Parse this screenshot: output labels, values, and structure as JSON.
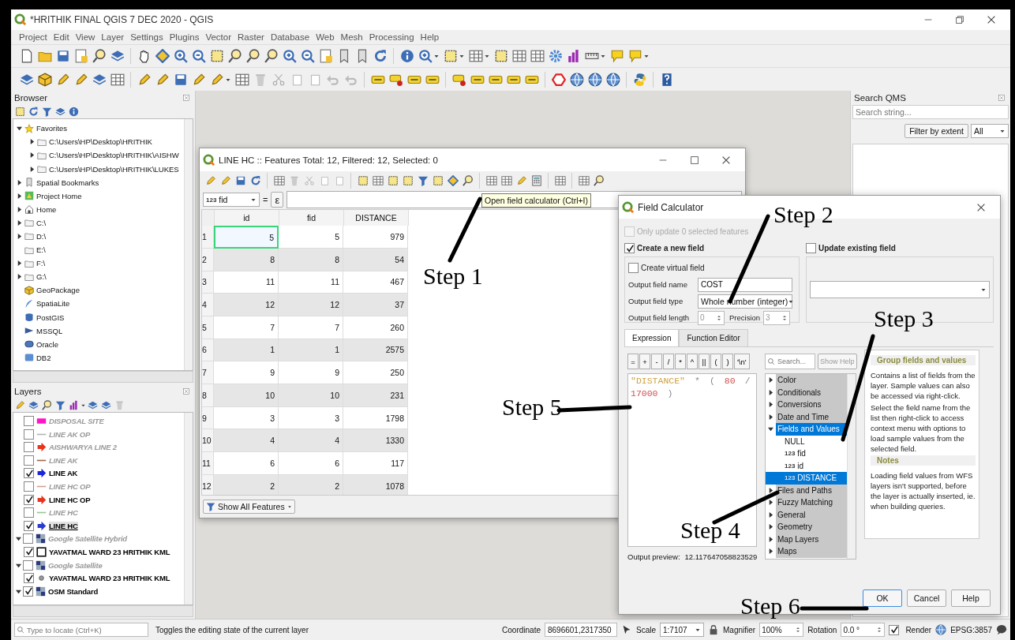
{
  "window": {
    "title": "*HRITHIK FINAL QGIS 7 DEC 2020 - QGIS"
  },
  "menu": [
    "Project",
    "Edit",
    "View",
    "Layer",
    "Settings",
    "Plugins",
    "Vector",
    "Raster",
    "Database",
    "Web",
    "Mesh",
    "Processing",
    "Help"
  ],
  "browser": {
    "title": "Browser",
    "items": [
      {
        "label": "Favorites",
        "kind": "star",
        "expanded": true,
        "children": [
          {
            "label": "C:\\Users\\HP\\Desktop\\HRITHIK",
            "kind": "folder",
            "expanded": false
          },
          {
            "label": "C:\\Users\\HP\\Desktop\\HRITHIK\\AISHW",
            "kind": "folder",
            "expanded": false
          },
          {
            "label": "C:\\Users\\HP\\Desktop\\HRITHIK\\LUKES",
            "kind": "folder",
            "expanded": false
          }
        ]
      },
      {
        "label": "Spatial Bookmarks",
        "kind": "bookmarks",
        "expanded": false
      },
      {
        "label": "Project Home",
        "kind": "project",
        "expanded": false
      },
      {
        "label": "Home",
        "kind": "home",
        "expanded": false
      },
      {
        "label": "C:\\",
        "kind": "folder",
        "expanded": false
      },
      {
        "label": "D:\\",
        "kind": "folder",
        "expanded": false
      },
      {
        "label": "E:\\",
        "kind": "folder"
      },
      {
        "label": "F:\\",
        "kind": "folder",
        "expanded": false
      },
      {
        "label": "G:\\",
        "kind": "folder",
        "expanded": false
      },
      {
        "label": "GeoPackage",
        "kind": "geopackage"
      },
      {
        "label": "SpatiaLite",
        "kind": "spatialite"
      },
      {
        "label": "PostGIS",
        "kind": "postgis"
      },
      {
        "label": "MSSQL",
        "kind": "mssql"
      },
      {
        "label": "Oracle",
        "kind": "oracle"
      },
      {
        "label": "DB2",
        "kind": "db2"
      }
    ]
  },
  "layers": {
    "title": "Layers",
    "items": [
      {
        "label": "DISPOSAL SITE",
        "checked": false,
        "selected": false,
        "kind": "fill",
        "color": "#ff14c8"
      },
      {
        "label": "LINE AK OP",
        "checked": false,
        "selected": false,
        "kind": "line",
        "color": "#b4b4b4"
      },
      {
        "label": "AISHWARYA LINE 2",
        "checked": false,
        "selected": false,
        "kind": "arrow",
        "color": "#e8341c"
      },
      {
        "label": "LINE AK",
        "checked": false,
        "selected": false,
        "kind": "line",
        "color": "#9a6a48"
      },
      {
        "label": "LINE AK",
        "checked": true,
        "selected": false,
        "kind": "arrow",
        "color": "#1a24d8"
      },
      {
        "label": "LINE HC OP",
        "checked": false,
        "selected": false,
        "kind": "line",
        "color": "#d0a090"
      },
      {
        "label": "LINE HC OP",
        "checked": true,
        "selected": false,
        "kind": "arrow",
        "color": "#e8341c"
      },
      {
        "label": "LINE HC",
        "checked": false,
        "selected": false,
        "kind": "line",
        "color": "#98c498"
      },
      {
        "label": "LINE HC",
        "checked": true,
        "selected": true,
        "kind": "arrow",
        "color": "#2a3ad0"
      },
      {
        "label": "Google Satellite Hybrid",
        "checked": false,
        "selected": false,
        "kind": "tile",
        "expanded": true
      },
      {
        "label": "YAVATMAL WARD 23 HRITHIK KML",
        "checked": true,
        "selected": false,
        "kind": "square"
      },
      {
        "label": "Google Satellite",
        "checked": false,
        "selected": false,
        "kind": "tile",
        "expanded": true
      },
      {
        "label": "YAVATMAL WARD 23 HRITHIK KML",
        "checked": true,
        "selected": false,
        "kind": "point"
      },
      {
        "label": "OSM Standard",
        "checked": true,
        "selected": false,
        "kind": "tile",
        "expanded": true
      }
    ]
  },
  "search_qms": {
    "title": "Search QMS",
    "placeholder": "Search string...",
    "filter_button": "Filter by extent",
    "filter_value": "All"
  },
  "attribute_table": {
    "title": "LINE HC :: Features Total: 12, Filtered: 12, Selected: 0",
    "field_type_badge": "123",
    "field_value": "fid",
    "operator": "=",
    "expression_button": "ε",
    "columns": [
      "id",
      "fid",
      "DISTANCE"
    ],
    "rows": [
      {
        "number": "1",
        "cells": [
          "5",
          "5",
          "979"
        ],
        "selected": false,
        "focused": true
      },
      {
        "number": "2",
        "cells": [
          "8",
          "8",
          "54"
        ],
        "selected": false,
        "focused": false
      },
      {
        "number": "3",
        "cells": [
          "11",
          "11",
          "467"
        ],
        "selected": false,
        "focused": false
      },
      {
        "number": "4",
        "cells": [
          "12",
          "12",
          "37"
        ],
        "selected": false,
        "focused": false
      },
      {
        "number": "5",
        "cells": [
          "7",
          "7",
          "260"
        ],
        "selected": false,
        "focused": false
      },
      {
        "number": "6",
        "cells": [
          "1",
          "1",
          "2575"
        ],
        "selected": false,
        "focused": false
      },
      {
        "number": "7",
        "cells": [
          "9",
          "9",
          "250"
        ],
        "selected": false,
        "focused": false
      },
      {
        "number": "8",
        "cells": [
          "10",
          "10",
          "231"
        ],
        "selected": false,
        "focused": false
      },
      {
        "number": "9",
        "cells": [
          "3",
          "3",
          "1798"
        ],
        "selected": false,
        "focused": false
      },
      {
        "number": "10",
        "cells": [
          "4",
          "4",
          "1330"
        ],
        "selected": false,
        "focused": false
      },
      {
        "number": "11",
        "cells": [
          "6",
          "6",
          "117"
        ],
        "selected": false,
        "focused": false
      },
      {
        "number": "12",
        "cells": [
          "2",
          "2",
          "1078"
        ],
        "selected": false,
        "focused": false
      }
    ],
    "show_all": "Show All Features"
  },
  "tooltip": {
    "text": "Open field calculator (Ctrl+I)"
  },
  "field_calculator": {
    "title": "Field Calculator",
    "only_update": {
      "label": "Only update 0 selected features",
      "checked": false,
      "disabled": true
    },
    "create_new": {
      "label": "Create a new field",
      "checked": true
    },
    "virtual": {
      "label": "Create virtual field",
      "checked": false
    },
    "name_label": "Output field name",
    "name_value": "COST",
    "type_label": "Output field type",
    "type_value": "Whole number (integer)",
    "length_label": "Output field length",
    "length_value": "0",
    "precision_label": "Precision",
    "precision_value": "3",
    "update_existing": {
      "label": "Update existing field",
      "checked": false
    },
    "tabs": [
      {
        "label": "Expression",
        "selected": true
      },
      {
        "label": "Function Editor",
        "selected": false
      }
    ],
    "operators": [
      "=",
      "+",
      "-",
      "/",
      "*",
      "^",
      "||",
      "(",
      ")",
      "'\\n'"
    ],
    "expression_lines": [
      [
        {
          "text": "\"DISTANCE\"",
          "kind": "field"
        },
        {
          "text": "*",
          "kind": "operator"
        },
        {
          "text": "(",
          "kind": "operator"
        },
        {
          "text": "80",
          "kind": "number"
        },
        {
          "text": "/",
          "kind": "operator"
        }
      ],
      [
        {
          "text": "17000",
          "kind": "number"
        },
        {
          "text": ")",
          "kind": "operator"
        }
      ]
    ],
    "preview_label": "Output preview:",
    "preview_value": "12.117647058823529",
    "search_placeholder": "Search...",
    "show_help": "Show Help",
    "functions": [
      {
        "label": "Color",
        "expanded": false,
        "selected": false
      },
      {
        "label": "Conditionals",
        "expanded": false,
        "selected": false
      },
      {
        "label": "Conversions",
        "expanded": false,
        "selected": false
      },
      {
        "label": "Date and Time",
        "expanded": false,
        "selected": false
      },
      {
        "label": "Fields and Values",
        "expanded": true,
        "selected": true,
        "children": [
          {
            "label": "NULL",
            "selected": false
          },
          {
            "type_badge": "123",
            "label": "fid",
            "selected": false
          },
          {
            "type_badge": "123",
            "label": "id",
            "selected": false
          },
          {
            "type_badge": "123",
            "label": "DISTANCE",
            "selected": true
          }
        ]
      },
      {
        "label": "Files and Paths",
        "expanded": false,
        "selected": false
      },
      {
        "label": "Fuzzy Matching",
        "expanded": false,
        "selected": false
      },
      {
        "label": "General",
        "expanded": false,
        "selected": false
      },
      {
        "label": "Geometry",
        "expanded": false,
        "selected": false
      },
      {
        "label": "Map Layers",
        "expanded": false,
        "selected": false
      },
      {
        "label": "Maps",
        "expanded": false,
        "selected": false
      }
    ],
    "help": {
      "title": "Group fields and values",
      "paragraphs": [
        "Contains a list of fields from the layer. Sample values can also be accessed via right-click.",
        "Select the field name from the list then right-click to access context menu with options to load sample values from the selected field."
      ],
      "notes_title": "Notes",
      "notes": "Loading field values from WFS layers isn't supported, before the layer is actually inserted, ie. when building queries."
    },
    "buttons": [
      {
        "label": "OK",
        "default": true
      },
      {
        "label": "Cancel",
        "default": false
      },
      {
        "label": "Help",
        "default": false
      }
    ]
  },
  "status_bar": {
    "locate_placeholder": "Type to locate (Ctrl+K)",
    "message": "Toggles the editing state of the current layer",
    "coordinate_label": "Coordinate",
    "coordinate": "8696601,2317350",
    "scale_label": "Scale",
    "scale": "1:7107",
    "magnifier_label": "Magnifier",
    "magnifier": "100%",
    "rotation_label": "Rotation",
    "rotation": "0.0 °",
    "render": {
      "label": "Render",
      "checked": true
    },
    "crs": "EPSG:3857"
  },
  "annotations": [
    {
      "text": "Step 1"
    },
    {
      "text": "Step 2"
    },
    {
      "text": "Step 3"
    },
    {
      "text": "Step 4"
    },
    {
      "text": "Step 5"
    },
    {
      "text": "Step 6"
    }
  ]
}
